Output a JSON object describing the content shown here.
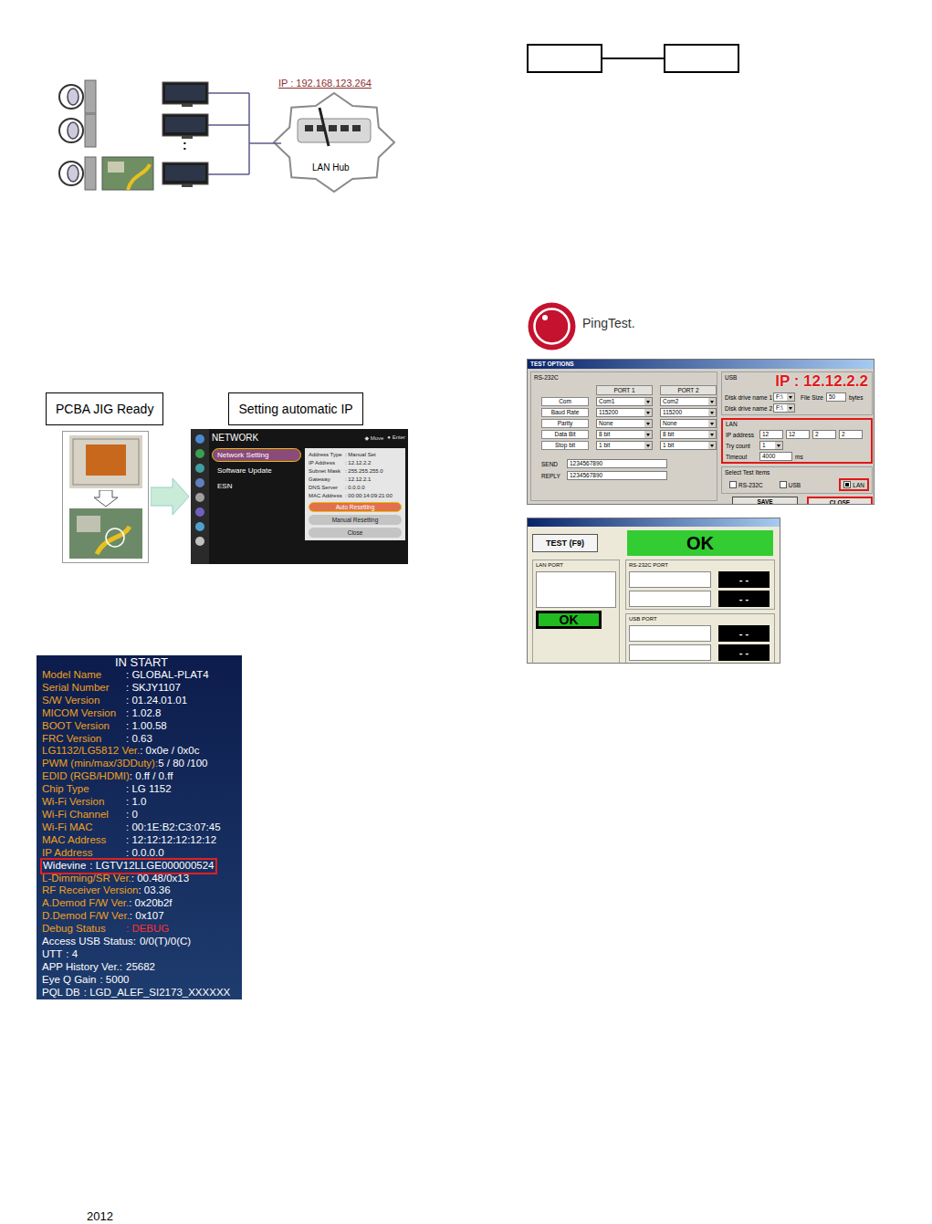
{
  "diagram": {
    "ip_label": "IP : 192.168.123.264",
    "hub_label": "LAN Hub",
    "more": ":"
  },
  "jig_steps": [
    {
      "label": "PCBA JIG Ready"
    },
    {
      "label": "Setting automatic IP"
    }
  ],
  "network_menu": {
    "title": "NETWORK",
    "hint_move": "◆ Move",
    "hint_enter": "● Enter",
    "items": [
      {
        "label": "Network Setting",
        "selected": true
      },
      {
        "label": "Software Update",
        "selected": false
      },
      {
        "label": "ESN",
        "selected": false
      }
    ],
    "details": [
      {
        "label": "Address Type",
        "value": ": Manual Set"
      },
      {
        "label": "IP Address",
        "value": ": 12.12.2.2"
      },
      {
        "label": "Subnet Mask",
        "value": ": 255.255.255.0"
      },
      {
        "label": "Gateway",
        "value": ": 12.12.2.1"
      },
      {
        "label": "DNS Server",
        "value": ": 0.0.0.0"
      },
      {
        "label": "MAC Address",
        "value": ": 00:00:14:09:21:00"
      }
    ],
    "buttons": [
      {
        "label": "Auto Resetting",
        "selected": true
      },
      {
        "label": "Manual Resetting",
        "selected": false
      },
      {
        "label": "Close",
        "selected": false
      }
    ]
  },
  "info_screen": {
    "title": "IN START",
    "items": [
      {
        "label": "Model Name",
        "value": ": GLOBAL-PLAT4",
        "kind": "column",
        "color": "#f0a020",
        "value_color": "#ffffff",
        "highlighted": false
      },
      {
        "label": "Serial Number",
        "value": ": SKJY1107",
        "kind": "column",
        "color": "#f0a020",
        "value_color": "#ffffff",
        "highlighted": false
      },
      {
        "label": "S/W Version",
        "value": ": 01.24.01.01",
        "kind": "column",
        "color": "#f0a020",
        "value_color": "#ffffff",
        "highlighted": false
      },
      {
        "label": "MICOM Version",
        "value": ": 1.02.8",
        "kind": "column",
        "color": "#f0a020",
        "value_color": "#ffffff",
        "highlighted": false
      },
      {
        "label": "BOOT Version",
        "value": ": 1.00.58",
        "kind": "column",
        "color": "#f0a020",
        "value_color": "#ffffff",
        "highlighted": false
      },
      {
        "label": "FRC Version",
        "value": ": 0.63",
        "kind": "column",
        "color": "#f0a020",
        "value_color": "#ffffff",
        "highlighted": false
      },
      {
        "label": "LG1132/LG5812 Ver.",
        "value": ": 0x0e / 0x0c",
        "kind": "column",
        "color": "#f0a020",
        "value_color": "#ffffff",
        "highlighted": false
      },
      {
        "label": "PWM (min/max/3DDuty):",
        "value": "5 / 80 /100",
        "kind": "column",
        "color": "#f0a020",
        "value_color": "#ffffff",
        "highlighted": false
      },
      {
        "label": "EDID (RGB/HDMI)",
        "value": ": 0.ff / 0.ff",
        "kind": "column",
        "color": "#f0a020",
        "value_color": "#ffffff",
        "highlighted": false
      },
      {
        "label": "Chip Type",
        "value": ": LG 1152",
        "kind": "column",
        "color": "#f0a020",
        "value_color": "#ffffff",
        "highlighted": false
      },
      {
        "label": "Wi-Fi Version",
        "value": ": 1.0",
        "kind": "column",
        "color": "#f0a020",
        "value_color": "#ffffff",
        "highlighted": false
      },
      {
        "label": "Wi-Fi Channel",
        "value": ": 0",
        "kind": "column",
        "color": "#f0a020",
        "value_color": "#ffffff",
        "highlighted": false
      },
      {
        "label": "Wi-Fi MAC",
        "value": ": 00:1E:B2:C3:07:45",
        "kind": "column",
        "color": "#f0a020",
        "value_color": "#ffffff",
        "highlighted": false
      },
      {
        "label": "MAC Address",
        "value": ": 12:12:12:12:12:12",
        "kind": "column",
        "color": "#f0a020",
        "value_color": "#ffffff",
        "highlighted": false
      },
      {
        "label": "IP Address",
        "value": ": 0.0.0.0",
        "kind": "column",
        "color": "#f0a020",
        "value_color": "#ffffff",
        "highlighted": false
      },
      {
        "label": "Widevine",
        "value": ": LGTV12LLGE000000524",
        "kind": "inline",
        "color": "#ffffff",
        "value_color": "#ffffff",
        "highlighted": true
      },
      {
        "label": "L-Dimming/SR Ver.",
        "value": ": 00.48/0x13",
        "kind": "column",
        "color": "#f0a020",
        "value_color": "#ffffff",
        "highlighted": false
      },
      {
        "label": "RF Receiver Version",
        "value": ": 03.36",
        "kind": "column",
        "color": "#f0a020",
        "value_color": "#ffffff",
        "highlighted": false
      },
      {
        "label": "A.Demod F/W Ver.",
        "value": ": 0x20b2f",
        "kind": "column",
        "color": "#f0a020",
        "value_color": "#ffffff",
        "highlighted": false
      },
      {
        "label": "D.Demod F/W Ver.",
        "value": ": 0x107",
        "kind": "column",
        "color": "#f0a020",
        "value_color": "#ffffff",
        "highlighted": false
      },
      {
        "label": "Debug Status",
        "value": ": DEBUG",
        "kind": "column",
        "color": "#f0a020",
        "value_color": "#ff3030",
        "highlighted": false
      },
      {
        "label": "Access USB Status:",
        "value": "0/0(T)/0(C)",
        "kind": "inline",
        "color": "#ffffff",
        "value_color": "#ffffff",
        "highlighted": false
      },
      {
        "label": "UTT",
        "value": ": 4",
        "kind": "inline",
        "color": "#ffffff",
        "value_color": "#ffffff",
        "highlighted": false
      },
      {
        "label": "APP History Ver.:",
        "value": "25682",
        "kind": "inline",
        "color": "#ffffff",
        "value_color": "#ffffff",
        "highlighted": false
      },
      {
        "label": "Eye Q Gain",
        "value": ": 5000",
        "kind": "inline",
        "color": "#ffffff",
        "value_color": "#ffffff",
        "highlighted": false
      },
      {
        "label": "PQL DB",
        "value": ": LGD_ALEF_SI2173_XXXXXX",
        "kind": "inline",
        "color": "#ffffff",
        "value_color": "#ffffff",
        "highlighted": false
      }
    ]
  },
  "ping_test": {
    "title": "PingTest."
  },
  "options_window": {
    "title": "TEST OPTIONS",
    "rs232_title": "RS-232C",
    "port_headers": [
      "PORT 1",
      "PORT 2"
    ],
    "rows": [
      {
        "label": "Com",
        "port1": "Com1",
        "port2": "Com2"
      },
      {
        "label": "Baud Rate",
        "port1": "115200",
        "port2": "115200"
      },
      {
        "label": "Parity",
        "port1": "None",
        "port2": "None"
      },
      {
        "label": "Data Bit",
        "port1": "8 bit",
        "port2": "8 bit"
      },
      {
        "label": "Stop bit",
        "port1": "1 bit",
        "port2": "1 bit"
      }
    ],
    "send_label": "SEND",
    "send_value": "1234567890",
    "reply_label": "REPLY",
    "reply_value": "1234567890",
    "usb_title": "USB",
    "usb_fields": [
      {
        "label": "Disk drive name 1",
        "value": "F:\\"
      },
      {
        "label": "Disk drive name 2",
        "value": "F:\\"
      }
    ],
    "file_size_label": "File Size",
    "file_size_value": "50",
    "file_size_unit": "bytes",
    "ip_overlay": "IP : 12.12.2.2",
    "lan_title": "LAN",
    "ip_label": "IP address",
    "ip_parts": [
      "12",
      "12",
      "2",
      "2"
    ],
    "try_label": "Try count",
    "try_value": "1",
    "timeout_label": "Timeout",
    "timeout_value": "4000",
    "timeout_unit": "ms",
    "select_title": "Select Test Items",
    "test_items": [
      {
        "label": "RS-232C",
        "checked": false
      },
      {
        "label": "USB",
        "checked": false
      },
      {
        "label": "LAN",
        "checked": true
      }
    ],
    "buttons": [
      "SAVE",
      "CLOSE"
    ]
  },
  "result_window": {
    "test_button": "TEST (F9)",
    "overall": "OK",
    "lan_title": "LAN PORT",
    "lan_result": "OK",
    "rs232_title": "RS-232C PORT",
    "rs232_results": [
      "- -",
      "- -"
    ],
    "usb_title": "USB PORT",
    "usb_results": [
      "- -",
      "- -"
    ]
  },
  "footer": {
    "year": "2012"
  }
}
